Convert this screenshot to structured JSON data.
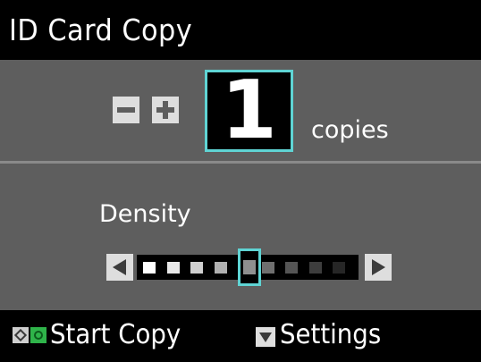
{
  "title": "ID Card Copy",
  "copies": {
    "value": "1",
    "label": "copies"
  },
  "density": {
    "label": "Density",
    "segments": 9,
    "level": 5,
    "segment_colors": [
      "#ffffff",
      "#e8e8e8",
      "#cfcfcf",
      "#b0b0b0",
      "#8f8f8f",
      "#6f6f6f",
      "#555555",
      "#3d3d3d",
      "#262626"
    ]
  },
  "footer": {
    "start_label": "Start Copy",
    "settings_label": "Settings"
  },
  "colors": {
    "highlight": "#5fd4d4",
    "panel": "#5e5e5e",
    "start_green": "#2fb44a"
  }
}
